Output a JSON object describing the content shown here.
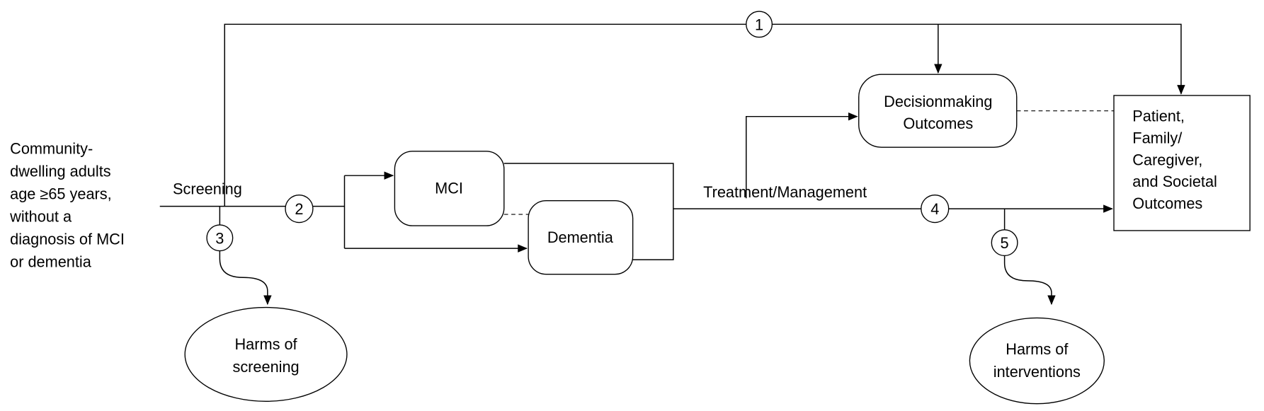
{
  "population": [
    "Community-",
    "dwelling adults",
    "age ≥65 years,",
    "without a",
    "diagnosis of MCI",
    "or dementia"
  ],
  "labels": {
    "screening": "Screening",
    "treatment": "Treatment/Management"
  },
  "nodes": {
    "mci": "MCI",
    "dementia": "Dementia",
    "decision": [
      "Decisionmaking",
      "Outcomes"
    ],
    "outcomes": [
      "Patient,",
      "Family/",
      "Caregiver,",
      "and Societal",
      "Outcomes"
    ],
    "harms_screening": [
      "Harms of",
      "screening"
    ],
    "harms_interventions": [
      "Harms of",
      "interventions"
    ]
  },
  "key_questions": [
    "1",
    "2",
    "3",
    "4",
    "5"
  ]
}
